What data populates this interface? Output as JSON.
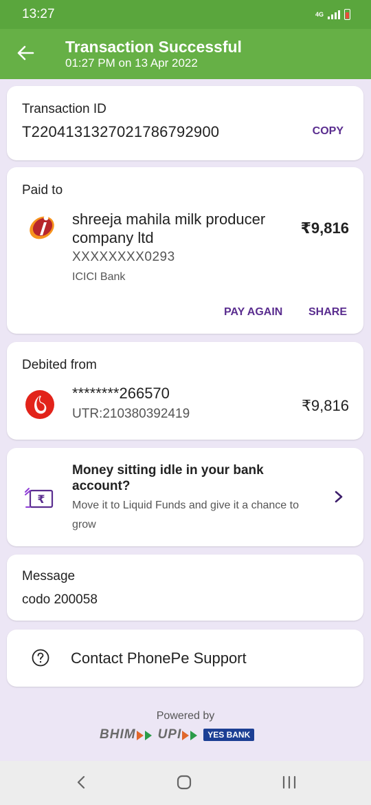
{
  "status_bar": {
    "time": "13:27",
    "network": "4G"
  },
  "header": {
    "title": "Transaction Successful",
    "subtitle": "01:27 PM on 13 Apr 2022"
  },
  "transaction": {
    "label": "Transaction ID",
    "id": "T2204131327021786792900",
    "copy_label": "COPY"
  },
  "paid_to": {
    "label": "Paid to",
    "name": "shreeja mahila milk producer company ltd",
    "account": "XXXXXXXX0293",
    "bank": "ICICI Bank",
    "amount": "₹9,816",
    "pay_again_label": "PAY AGAIN",
    "share_label": "SHARE"
  },
  "debited_from": {
    "label": "Debited from",
    "account": "********266570",
    "utr": "UTR:210380392419",
    "amount": "₹9,816"
  },
  "promo": {
    "title": "Money sitting idle in your bank account?",
    "body": "Move it to Liquid Funds and give it a chance to grow"
  },
  "message": {
    "label": "Message",
    "text": "codo 200058"
  },
  "support": {
    "label": "Contact PhonePe Support"
  },
  "footer": {
    "powered_by": "Powered by",
    "bhim": "BHIM",
    "upi": "UPI",
    "yes_bank": "YES BANK"
  },
  "colors": {
    "header_green": "#66b046",
    "accent_purple": "#5a2d8f",
    "background": "#ece6f5"
  },
  "icons": {
    "back": "back-arrow-icon",
    "payee_logo": "icici-logo-icon",
    "bank_logo": "bank-logo-icon",
    "promo": "rupee-wallet-icon",
    "chevron": "chevron-right-icon",
    "help": "help-circle-icon"
  }
}
